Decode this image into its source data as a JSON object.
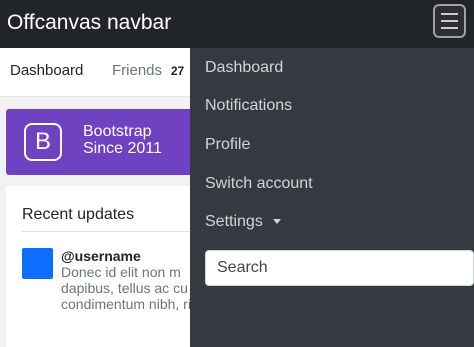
{
  "navbar": {
    "brand": "Offcanvas navbar",
    "toggle_icon": "hamburger-menu-icon"
  },
  "subnav": {
    "dashboard": "Dashboard",
    "friends": "Friends",
    "friends_badge": "27"
  },
  "banner": {
    "logo_text": "B",
    "title": "Bootstrap",
    "subtitle": "Since 2011",
    "background_color": "#6f42c1"
  },
  "card": {
    "title": "Recent updates",
    "post": {
      "username": "@username",
      "text": "Donec id elit non m dapibus, tellus ac cu condimentum nibh, risus."
    }
  },
  "offcanvas": {
    "items": [
      {
        "label": "Dashboard"
      },
      {
        "label": "Notifications"
      },
      {
        "label": "Profile"
      },
      {
        "label": "Switch account"
      },
      {
        "label": "Settings"
      }
    ],
    "search_placeholder": "Search",
    "background_color": "#343a40"
  }
}
